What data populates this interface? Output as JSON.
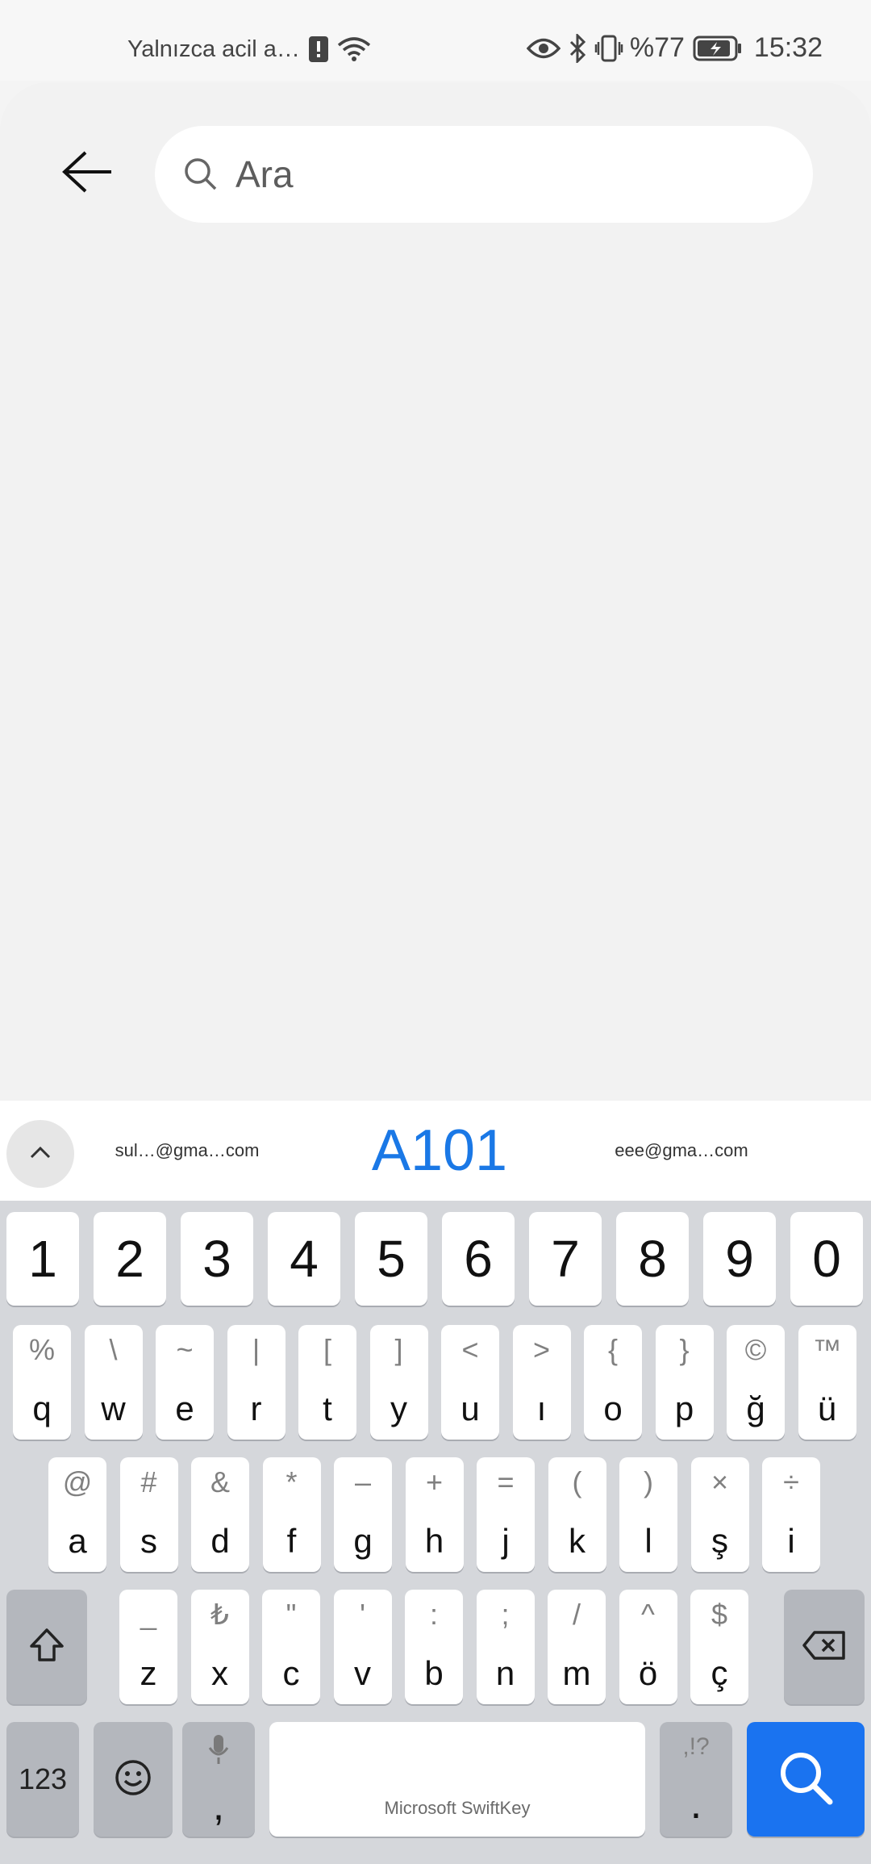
{
  "status_bar": {
    "carrier": "Yalnızca acil a…",
    "battery": "%77",
    "time": "15:32",
    "icons": [
      "alert-icon",
      "wifi-icon",
      "eye-icon",
      "bluetooth-icon",
      "vibrate-icon",
      "battery-charging-icon"
    ]
  },
  "search": {
    "placeholder": "Ara",
    "value": ""
  },
  "suggestions": {
    "left": "sul…@gma…com",
    "center": "A101",
    "right": "eee@gma…com"
  },
  "keyboard": {
    "numbers": [
      "1",
      "2",
      "3",
      "4",
      "5",
      "6",
      "7",
      "8",
      "9",
      "0"
    ],
    "row1": [
      {
        "pri": "q",
        "sec": "%"
      },
      {
        "pri": "w",
        "sec": "\\"
      },
      {
        "pri": "e",
        "sec": "~"
      },
      {
        "pri": "r",
        "sec": "|"
      },
      {
        "pri": "t",
        "sec": "["
      },
      {
        "pri": "y",
        "sec": "]"
      },
      {
        "pri": "u",
        "sec": "<"
      },
      {
        "pri": "ı",
        "sec": ">"
      },
      {
        "pri": "o",
        "sec": "{"
      },
      {
        "pri": "p",
        "sec": "}"
      },
      {
        "pri": "ğ",
        "sec": "©"
      },
      {
        "pri": "ü",
        "sec": "™"
      }
    ],
    "row2": [
      {
        "pri": "a",
        "sec": "@"
      },
      {
        "pri": "s",
        "sec": "#"
      },
      {
        "pri": "d",
        "sec": "&"
      },
      {
        "pri": "f",
        "sec": "*"
      },
      {
        "pri": "g",
        "sec": "–"
      },
      {
        "pri": "h",
        "sec": "+"
      },
      {
        "pri": "j",
        "sec": "="
      },
      {
        "pri": "k",
        "sec": "("
      },
      {
        "pri": "l",
        "sec": ")"
      },
      {
        "pri": "ş",
        "sec": "×"
      },
      {
        "pri": "i",
        "sec": "÷"
      }
    ],
    "row3": [
      {
        "pri": "z",
        "sec": "_"
      },
      {
        "pri": "x",
        "sec": "₺"
      },
      {
        "pri": "c",
        "sec": "\""
      },
      {
        "pri": "v",
        "sec": "'"
      },
      {
        "pri": "b",
        "sec": ":"
      },
      {
        "pri": "n",
        "sec": ";"
      },
      {
        "pri": "m",
        "sec": "/"
      },
      {
        "pri": "ö",
        "sec": "^"
      },
      {
        "pri": "ç",
        "sec": "$"
      }
    ],
    "bottom": {
      "numbers_label": "123",
      "comma": ",",
      "space_label": "Microsoft SwiftKey",
      "period_sec": ",!?",
      "period": "."
    }
  },
  "colors": {
    "accent": "#1a73f0",
    "suggestion_highlight": "#1a78e6",
    "keyboard_bg": "#d5d7db"
  }
}
